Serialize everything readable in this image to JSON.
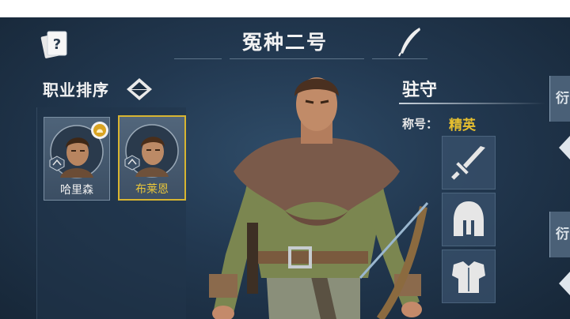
{
  "header": {
    "title": "冤种二号"
  },
  "roster": {
    "sort_label": "职业排序",
    "heroes": [
      {
        "name": "哈里森",
        "selected": false,
        "badge": "lion-badge-icon"
      },
      {
        "name": "布莱恩",
        "selected": true,
        "badge": null
      }
    ]
  },
  "hero_detail": {
    "class_name": "驻守",
    "rank_label": "称号：",
    "rank_value": "精英",
    "equipment_slots": [
      "sword-icon",
      "spartan-helmet-icon",
      "chest-armor-icon"
    ]
  },
  "right_tabs": [
    "衍",
    "衍"
  ],
  "colors": {
    "background": "#223850",
    "selected_border": "#d8b531",
    "rank_gold": "#e6bf2f"
  }
}
